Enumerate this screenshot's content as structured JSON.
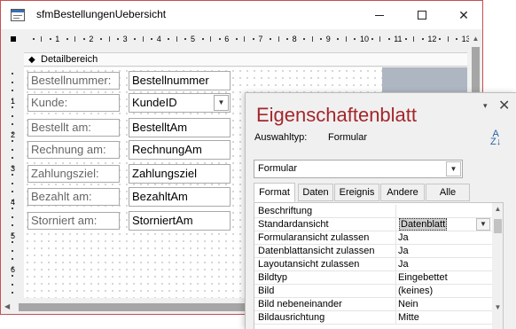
{
  "window": {
    "title": "sfmBestellungenUebersicht",
    "minimize_icon": "minimize-icon",
    "maximize_icon": "maximize-icon",
    "close_glyph": "✕"
  },
  "ruler": {
    "horizontal": [
      "1",
      "2",
      "3",
      "4",
      "5",
      "6",
      "7",
      "8",
      "9",
      "10",
      "11",
      "12",
      "13"
    ],
    "vertical": [
      "1",
      "2",
      "3",
      "4",
      "5",
      "6"
    ]
  },
  "section": {
    "arrow": "◆",
    "label": "Detailbereich"
  },
  "form_controls": [
    {
      "label": "Bestellnummer:",
      "field": "Bestellnummer"
    },
    {
      "label": "Kunde:",
      "field": "KundeID",
      "combo": true
    },
    {
      "label": "Bestellt am:",
      "field": "BestelltAm"
    },
    {
      "label": "Rechnung am:",
      "field": "RechnungAm"
    },
    {
      "label": "Zahlungsziel:",
      "field": "Zahlungsziel"
    },
    {
      "label": "Bezahlt am:",
      "field": "BezahltAm"
    },
    {
      "label": "Storniert am:",
      "field": "StorniertAm"
    }
  ],
  "property_sheet": {
    "title": "Eigenschaftenblatt",
    "selection_type_label": "Auswahltyp:",
    "selection_type_value": "Formular",
    "sort_top": "A",
    "sort_bottom": "Z↓",
    "object_select": "Formular",
    "pin_glyph": "▾",
    "close_glyph": "✕",
    "tabs": [
      "Format",
      "Daten",
      "Ereignis",
      "Andere",
      "Alle"
    ],
    "active_tab": "Format",
    "properties": [
      {
        "name": "Beschriftung",
        "value": ""
      },
      {
        "name": "Standardansicht",
        "value": "Datenblatt"
      },
      {
        "name": "Formularansicht zulassen",
        "value": "Ja"
      },
      {
        "name": "Datenblattansicht zulassen",
        "value": "Ja"
      },
      {
        "name": "Layoutansicht zulassen",
        "value": "Ja"
      },
      {
        "name": "Bildtyp",
        "value": "Eingebettet"
      },
      {
        "name": "Bild",
        "value": "(keines)"
      },
      {
        "name": "Bild nebeneinander",
        "value": "Nein"
      },
      {
        "name": "Bildausrichtung",
        "value": "Mitte"
      }
    ]
  },
  "colors": {
    "window_border": "#c75050",
    "property_title": "#a4262c",
    "sort_icon": "#2563a8",
    "offform_area": "#aeb6c2"
  }
}
